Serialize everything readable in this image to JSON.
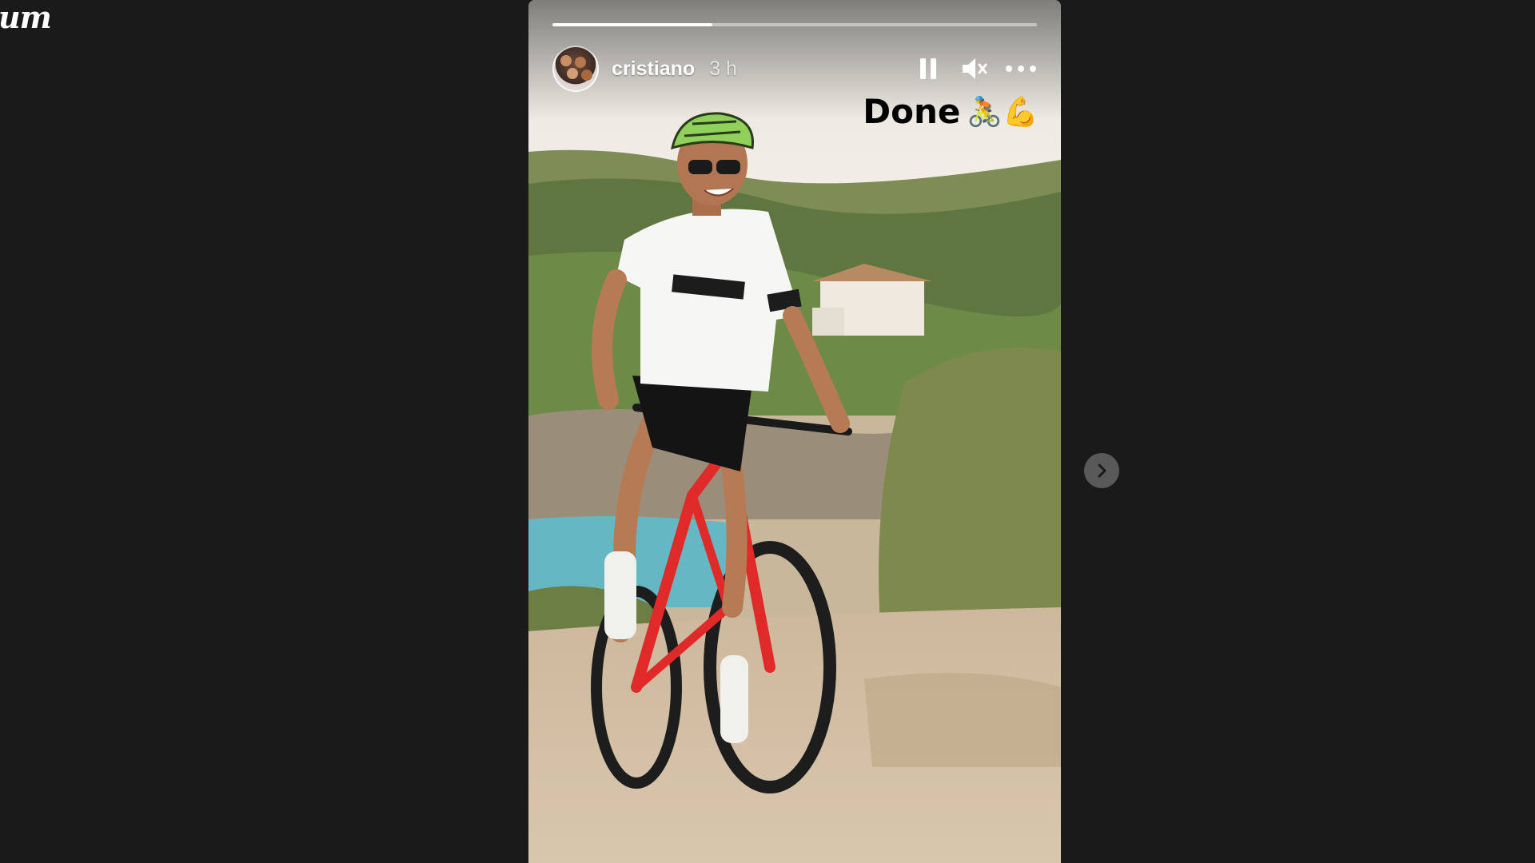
{
  "app": {
    "brand_fragment": "um"
  },
  "story": {
    "progress": 0.33,
    "user": {
      "username": "cristiano",
      "timestamp": "3 h"
    },
    "caption": {
      "text": "Done",
      "emoji": "🚴💪"
    },
    "controls": {
      "pause_icon": "pause-icon",
      "mute_icon": "speaker-muted-icon",
      "more_icon": "more-horizontal-icon"
    }
  },
  "navigation": {
    "next_icon": "chevron-right-icon"
  },
  "colors": {
    "page_background": "#1a1a1a",
    "progress_fill": "#ffffff",
    "bike_frame": "#e02a2a"
  }
}
